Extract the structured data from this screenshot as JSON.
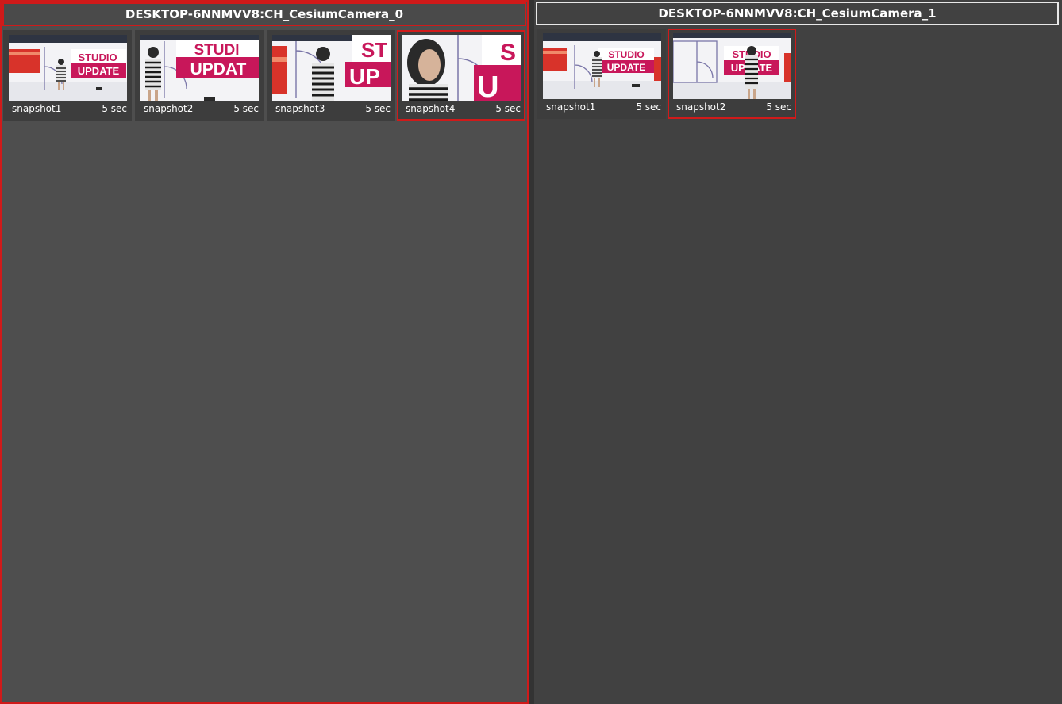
{
  "panels": [
    {
      "title": "DESKTOP-6NNMVV8:CH_CesiumCamera_0",
      "snapshots": [
        {
          "label": "snapshot1",
          "duration": "5 sec"
        },
        {
          "label": "snapshot2",
          "duration": "5 sec"
        },
        {
          "label": "snapshot3",
          "duration": "5 sec"
        },
        {
          "label": "snapshot4",
          "duration": "5 sec"
        }
      ]
    },
    {
      "title": "DESKTOP-6NNMVV8:CH_CesiumCamera_1",
      "snapshots": [
        {
          "label": "snapshot1",
          "duration": "5 sec"
        },
        {
          "label": "snapshot2",
          "duration": "5 sec"
        }
      ]
    }
  ],
  "thumb_text": {
    "line1": "STUDIO",
    "line2": "UPDATE"
  },
  "colors": {
    "selection": "#d01a1a",
    "brand_pink": "#c8175a",
    "panel_active": "#4e4e4e",
    "panel_inactive": "#414141"
  }
}
